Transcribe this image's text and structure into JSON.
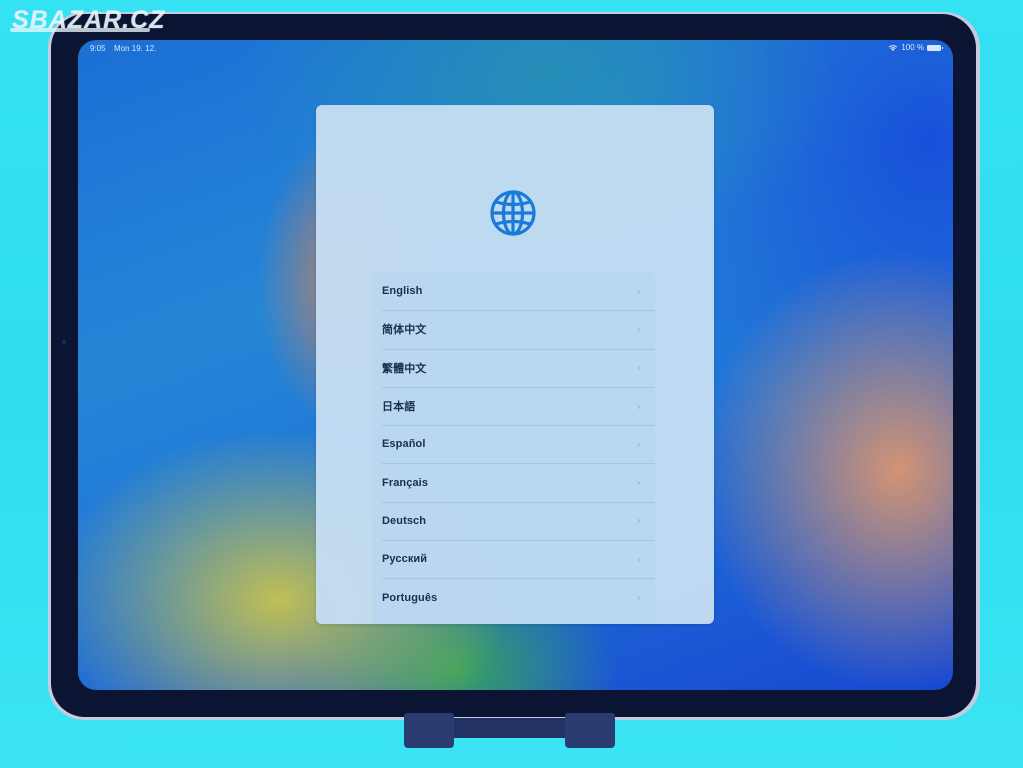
{
  "watermark": "SBAZAR.CZ",
  "status_bar": {
    "time": "9:05",
    "date": "Mon 19. 12.",
    "battery_text": "100 %",
    "icons": [
      "wifi-icon",
      "battery-icon"
    ]
  },
  "setup": {
    "icon": "globe-icon",
    "accent_color": "#1a7ad8",
    "languages": [
      {
        "label": "English"
      },
      {
        "label": "简体中文"
      },
      {
        "label": "繁體中文"
      },
      {
        "label": "日本語"
      },
      {
        "label": "Español"
      },
      {
        "label": "Français"
      },
      {
        "label": "Deutsch"
      },
      {
        "label": "Русский"
      },
      {
        "label": "Português"
      }
    ],
    "row_icon": "chevron-right-icon",
    "chevron": "›"
  }
}
